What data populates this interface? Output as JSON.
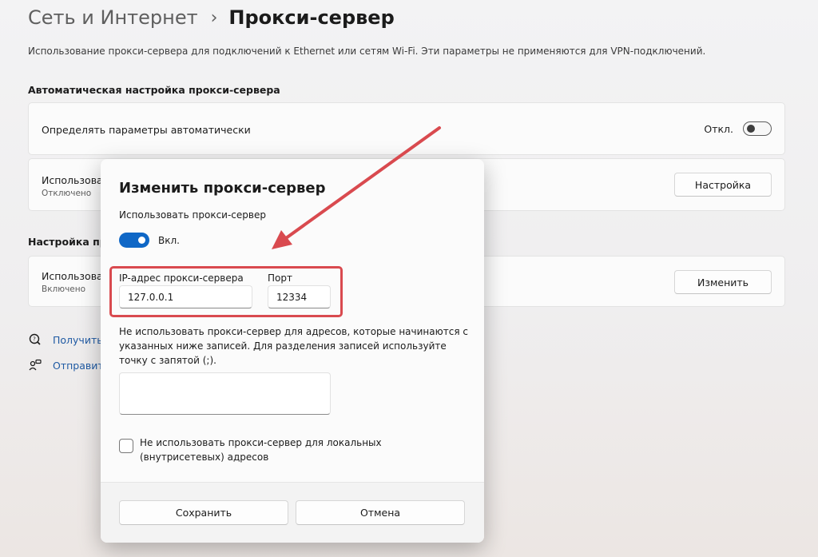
{
  "breadcrumb": {
    "parent": "Сеть и Интернет",
    "separator": "›",
    "current": "Прокси-сервер"
  },
  "description": "Использование прокси-сервера для подключений к Ethernet или сетям Wi-Fi. Эти параметры не применяются для VPN-подключений.",
  "auto_section": {
    "title": "Автоматическая настройка прокси-сервера",
    "detect_row": {
      "label": "Определять параметры автоматически",
      "toggle_state": "Откл."
    },
    "script_row": {
      "label": "Использовать сценарий настройки",
      "status": "Отключено",
      "button": "Настройка"
    }
  },
  "manual_section": {
    "title": "Настройка прокси-сервера вручную",
    "proxy_row": {
      "label": "Использовать прокси-сервер",
      "status": "Включено",
      "button": "Изменить"
    }
  },
  "links": [
    {
      "label": "Получить помощь",
      "icon": "help-chat-icon"
    },
    {
      "label": "Отправить отзыв",
      "icon": "feedback-icon"
    }
  ],
  "dialog": {
    "title": "Изменить прокси-сервер",
    "use_proxy_label": "Использовать прокси-сервер",
    "toggle_state": "Вкл.",
    "ip_label": "IP-адрес прокси-сервера",
    "ip_value": "127.0.0.1",
    "port_label": "Порт",
    "port_value": "12334",
    "exceptions_label": "Не использовать прокси-сервер для адресов, которые начинаются с указанных ниже записей. Для разделения записей используйте точку с запятой (;).",
    "exceptions_value": "",
    "local_checkbox_label": "Не использовать прокси-сервер для локальных (внутрисетевых) адресов",
    "local_checked": false,
    "save_button": "Сохранить",
    "cancel_button": "Отмена"
  },
  "colors": {
    "accent": "#0f67c6",
    "annotation": "#d94a4f",
    "link": "#1f5aa3"
  }
}
